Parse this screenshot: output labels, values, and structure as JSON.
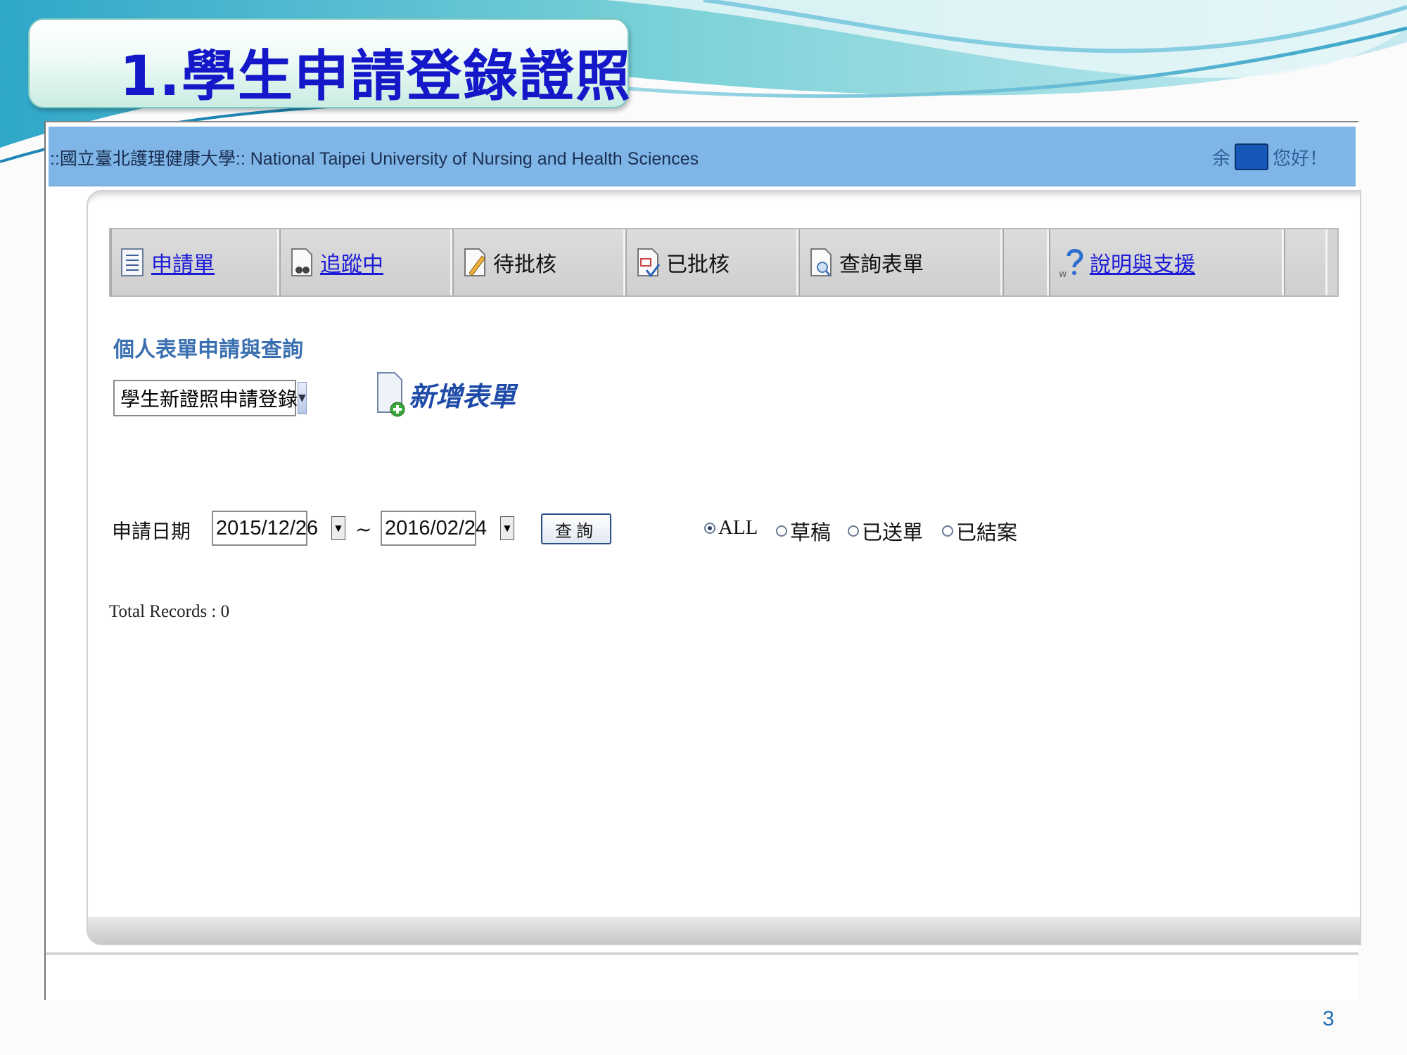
{
  "slide": {
    "title": "1.學生申請登錄證照",
    "page_number": "3"
  },
  "app": {
    "site_name": "::國立臺北護理健康大學:: National Taipei University of Nursing and Health Sciences",
    "greeting_surname": "余",
    "greeting_hello": "您好！"
  },
  "tabs": [
    {
      "label": "申請單",
      "icon": "form-list-icon",
      "link": true
    },
    {
      "label": "追蹤中",
      "icon": "binoculars-document-icon",
      "link": true
    },
    {
      "label": "待批核",
      "icon": "pencil-document-icon",
      "link": false
    },
    {
      "label": "已批核",
      "icon": "checked-document-icon",
      "link": false
    },
    {
      "label": "查詢表單",
      "icon": "magnifier-document-icon",
      "link": false
    },
    {
      "label": "",
      "icon": "",
      "link": false
    },
    {
      "label": "說明與支援",
      "icon": "help-question-icon",
      "link": true
    }
  ],
  "main": {
    "section_title": "個人表單申請與查詢",
    "form_type_selected": "學生新證照申請登錄",
    "new_form_label": "新增表單"
  },
  "query": {
    "date_label": "申請日期",
    "date_from": "2015/12/26",
    "separator": "~",
    "date_to": "2016/02/24",
    "search_label": "查詢",
    "status_options": [
      {
        "label": "ALL",
        "selected": true
      },
      {
        "label": "草稿",
        "selected": false
      },
      {
        "label": "已送單",
        "selected": false
      },
      {
        "label": "已結案",
        "selected": false
      }
    ],
    "total_records": "Total Records : 0"
  }
}
